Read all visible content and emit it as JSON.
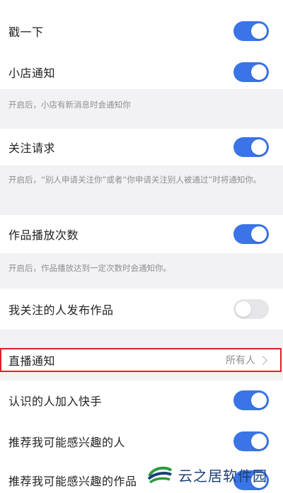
{
  "settings": {
    "poke": {
      "label": "戳一下",
      "enabled": true
    },
    "shop": {
      "label": "小店通知",
      "enabled": true,
      "description": "开启后，小店有新消息时会通知你"
    },
    "follow_request": {
      "label": "关注请求",
      "enabled": true,
      "description": "开启后，“别人申请关注你”或者“你申请关注别人被通过”时将通知你。"
    },
    "play_count": {
      "label": "作品播放次数",
      "enabled": true,
      "description": "开启后，作品播放达到一定次数时会通知你。"
    },
    "following_posts": {
      "label": "我关注的人发布作品",
      "enabled": false
    },
    "live": {
      "label": "直播通知",
      "value": "所有人"
    },
    "contacts_join": {
      "label": "认识的人加入快手",
      "enabled": true
    },
    "recommend_people": {
      "label": "推荐我可能感兴趣的人",
      "enabled": true
    },
    "recommend_works": {
      "label": "推荐我可能感兴趣的作品",
      "enabled": true
    }
  },
  "watermark": {
    "text": "云之居软件园"
  },
  "colors": {
    "toggle_on": "#3a74e6",
    "toggle_off": "#e6e6e8",
    "highlight": "#e0202a",
    "background": "#f2f2f4"
  }
}
